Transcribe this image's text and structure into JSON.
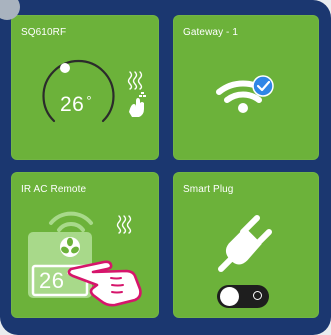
{
  "step_badge": "",
  "tiles": [
    {
      "label": "SQ610RF",
      "temperature": "26",
      "unit": "°"
    },
    {
      "label": "Gateway - 1"
    },
    {
      "label": "IR AC Remote",
      "temperature": "26",
      "unit": "°"
    },
    {
      "label": "Smart Plug"
    }
  ],
  "colors": {
    "frame": "#1b3770",
    "tile": "#6cb23a",
    "check": "#2f86e6",
    "hand": "#d6156b"
  },
  "icons": [
    "thermostat-dial-icon",
    "heat-waves-icon",
    "hand-signal-icon",
    "wifi-icon",
    "check-badge-icon",
    "ac-remote-icon",
    "plug-icon",
    "toggle-switch-icon",
    "pointing-hand-icon"
  ]
}
